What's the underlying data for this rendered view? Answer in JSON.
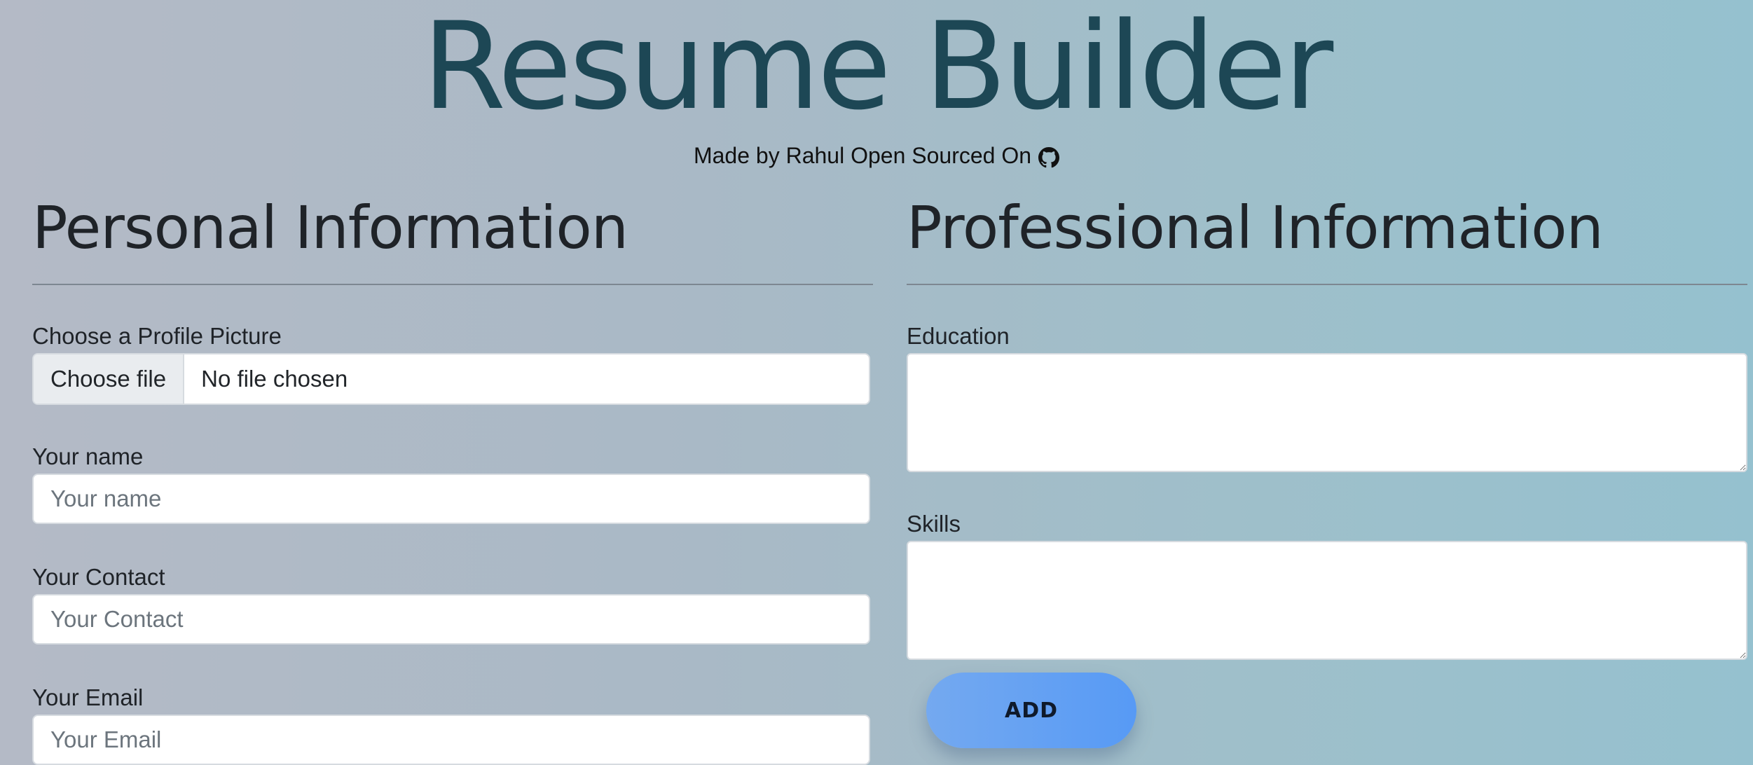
{
  "header": {
    "title": "Resume Builder",
    "credit_text": "Made by Rahul Open Sourced On",
    "credit_icon": "github-icon"
  },
  "personal": {
    "heading": "Personal Information",
    "profile_picture": {
      "label": "Choose a Profile Picture",
      "button_label": "Choose file",
      "status": "No file chosen"
    },
    "name": {
      "label": "Your name",
      "placeholder": "Your name",
      "value": ""
    },
    "contact": {
      "label": "Your Contact",
      "placeholder": "Your Contact",
      "value": ""
    },
    "email": {
      "label": "Your Email",
      "placeholder": "Your Email",
      "value": ""
    }
  },
  "professional": {
    "heading": "Professional Information",
    "education": {
      "label": "Education",
      "value": ""
    },
    "skills": {
      "label": "Skills",
      "value": ""
    },
    "add_button_label": "ADD"
  },
  "colors": {
    "title": "#1d4755",
    "button_gradient_start": "#74a9f0",
    "button_gradient_end": "#579af5"
  }
}
